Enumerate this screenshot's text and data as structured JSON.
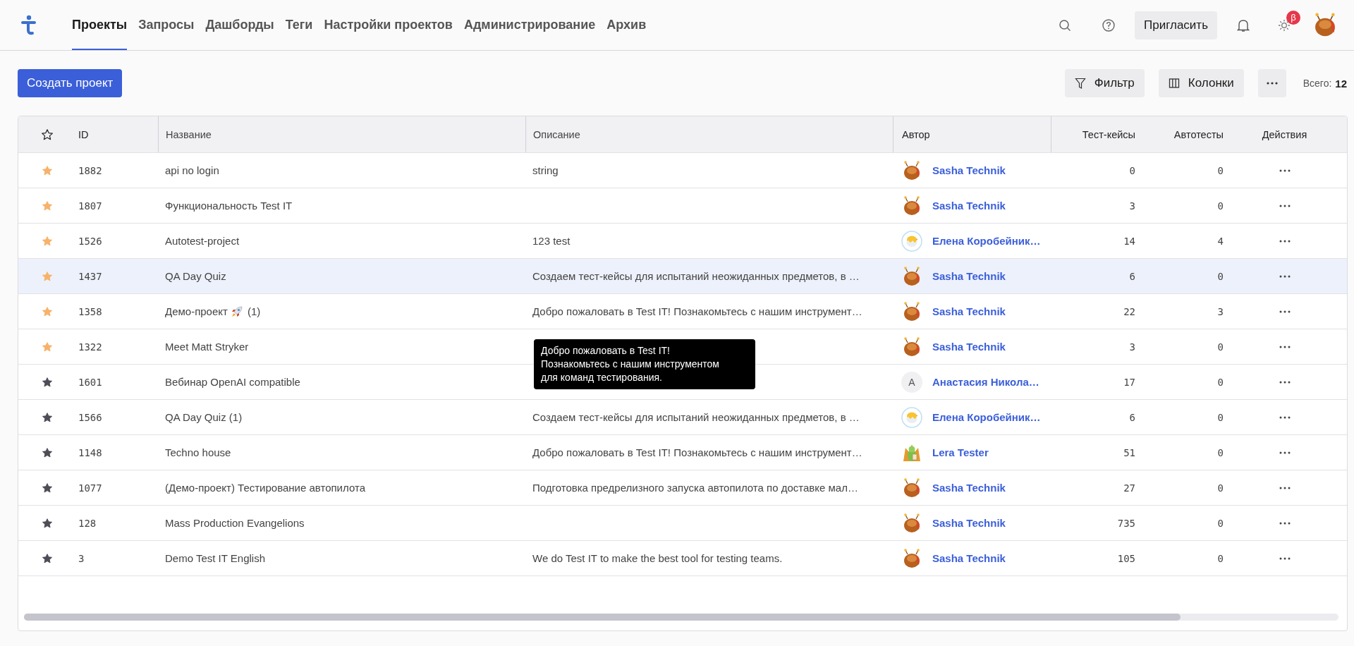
{
  "nav": {
    "items": [
      {
        "label": "Проекты",
        "selected": true
      },
      {
        "label": "Запросы",
        "selected": false
      },
      {
        "label": "Дашборды",
        "selected": false
      },
      {
        "label": "Теги",
        "selected": false
      },
      {
        "label": "Настройки проектов",
        "selected": false
      },
      {
        "label": "Администрирование",
        "selected": false
      },
      {
        "label": "Архив",
        "selected": false
      }
    ]
  },
  "header_actions": {
    "invite": "Пригласить",
    "theme_badge": "β"
  },
  "toolbar": {
    "create": "Создать проект",
    "filter": "Фильтр",
    "columns": "Колонки",
    "total_label": "Всего:",
    "total_value": "12"
  },
  "table": {
    "columns": [
      "ID",
      "Название",
      "Описание",
      "Автор",
      "Тест-кейсы",
      "Автотесты",
      "Действия"
    ],
    "rows": [
      {
        "favorite": true,
        "hovered": false,
        "id": "1882",
        "name": "api no login",
        "description": "string",
        "author": {
          "name": "Sasha Technik",
          "avatar": {
            "kind": "bug"
          }
        },
        "test_cases": "0",
        "autotests": "0"
      },
      {
        "favorite": true,
        "hovered": false,
        "id": "1807",
        "name": "Функциональность Test IT",
        "author": {
          "name": "Sasha Technik",
          "avatar": {
            "kind": "bug"
          }
        },
        "test_cases": "3",
        "autotests": "0"
      },
      {
        "favorite": true,
        "hovered": false,
        "id": "1526",
        "name": "Autotest-project",
        "description": "123 test",
        "author": {
          "name": "Елена Коробейник…",
          "avatar": {
            "kind": "chick"
          }
        },
        "test_cases": "14",
        "autotests": "4"
      },
      {
        "favorite": true,
        "hovered": true,
        "id": "1437",
        "name": "QA Day Quiz",
        "description": "Создаем тест-кейсы для испытаний неожиданных предметов, в …",
        "author": {
          "name": "Sasha Technik",
          "avatar": {
            "kind": "bug"
          }
        },
        "test_cases": "6",
        "autotests": "0"
      },
      {
        "favorite": true,
        "hovered": false,
        "id": "1358",
        "name": "Демо-проект",
        "name_icon": {
          "kind": "rocket"
        },
        "name_after": "(1)",
        "description": "Добро пожаловать в Test IT! Познакомьтесь с нашим инструмент…",
        "author": {
          "name": "Sasha Technik",
          "avatar": {
            "kind": "bug"
          }
        },
        "test_cases": "22",
        "autotests": "3"
      },
      {
        "favorite": true,
        "hovered": false,
        "id": "1322",
        "name": "Meet Matt Stryker",
        "author": {
          "name": "Sasha Technik",
          "avatar": {
            "kind": "bug"
          }
        },
        "test_cases": "3",
        "autotests": "0"
      },
      {
        "favorite": false,
        "hovered": false,
        "id": "1601",
        "name": "Вебинар OpenAI compatible",
        "author": {
          "name": "Анастасия Никола…",
          "avatar": {
            "kind": "letter",
            "initial": "A"
          }
        },
        "test_cases": "17",
        "autotests": "0"
      },
      {
        "favorite": false,
        "hovered": false,
        "id": "1566",
        "name": "QA Day Quiz (1)",
        "description": "Создаем тест-кейсы для испытаний неожиданных предметов, в …",
        "author": {
          "name": "Елена Коробейник…",
          "avatar": {
            "kind": "chick"
          }
        },
        "test_cases": "6",
        "autotests": "0"
      },
      {
        "favorite": false,
        "hovered": false,
        "id": "1148",
        "name": "Techno house",
        "description": "Добро пожаловать в Test IT! Познакомьтесь с нашим инструмент…",
        "author": {
          "name": "Lera Tester",
          "avatar": {
            "kind": "dragon"
          }
        },
        "test_cases": "51",
        "autotests": "0"
      },
      {
        "favorite": false,
        "hovered": false,
        "id": "1077",
        "name": "(Демо-проект) Тестирование автопилота",
        "description": "Подготовка предрелизного запуска автопилота по доставке мал…",
        "author": {
          "name": "Sasha Technik",
          "avatar": {
            "kind": "bug"
          }
        },
        "test_cases": "27",
        "autotests": "0"
      },
      {
        "favorite": false,
        "hovered": false,
        "id": "128",
        "name": "Mass Production Evangelions",
        "author": {
          "name": "Sasha Technik",
          "avatar": {
            "kind": "bug"
          }
        },
        "test_cases": "735",
        "autotests": "0"
      },
      {
        "favorite": false,
        "hovered": false,
        "id": "3",
        "name": "Demo Test IT English",
        "description": "We do Test IT to make the best tool for testing teams.",
        "author": {
          "name": "Sasha Technik",
          "avatar": {
            "kind": "bug"
          }
        },
        "test_cases": "105",
        "autotests": "0"
      }
    ]
  },
  "tooltip": {
    "text": "Добро пожаловать в Test IT!\nПознакомьтесь с нашим инструментом\nдля команд тестирования."
  }
}
